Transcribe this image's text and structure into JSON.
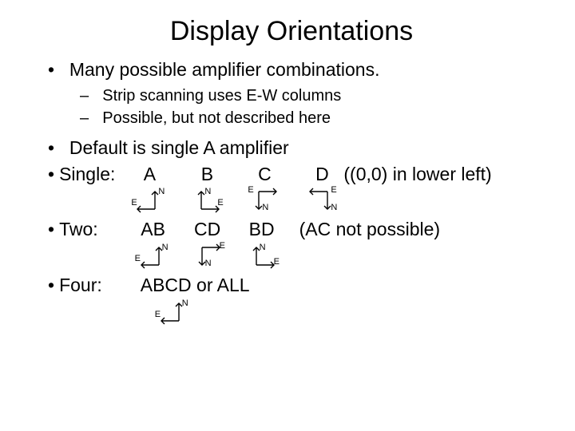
{
  "title": "Display Orientations",
  "bullets": {
    "combinations": "Many possible amplifier combinations.",
    "strip": "Strip scanning uses E-W columns",
    "possible": "Possible, but not described here",
    "default": "Default is single A amplifier",
    "singleLabel": "Single:",
    "twoLabel": "Two:",
    "fourLabel": "Four:"
  },
  "single": {
    "a": "A",
    "b": "B",
    "c": "C",
    "d": "D",
    "note": "((0,0) in lower left)"
  },
  "two": {
    "ab": "AB",
    "cd": "CD",
    "bd": "BD",
    "note": "(AC not possible)"
  },
  "four": {
    "abcd": "ABCD or ALL"
  },
  "compass": {
    "n": "N",
    "e": "E"
  },
  "marker": {
    "dot": "•",
    "dash": "–"
  }
}
